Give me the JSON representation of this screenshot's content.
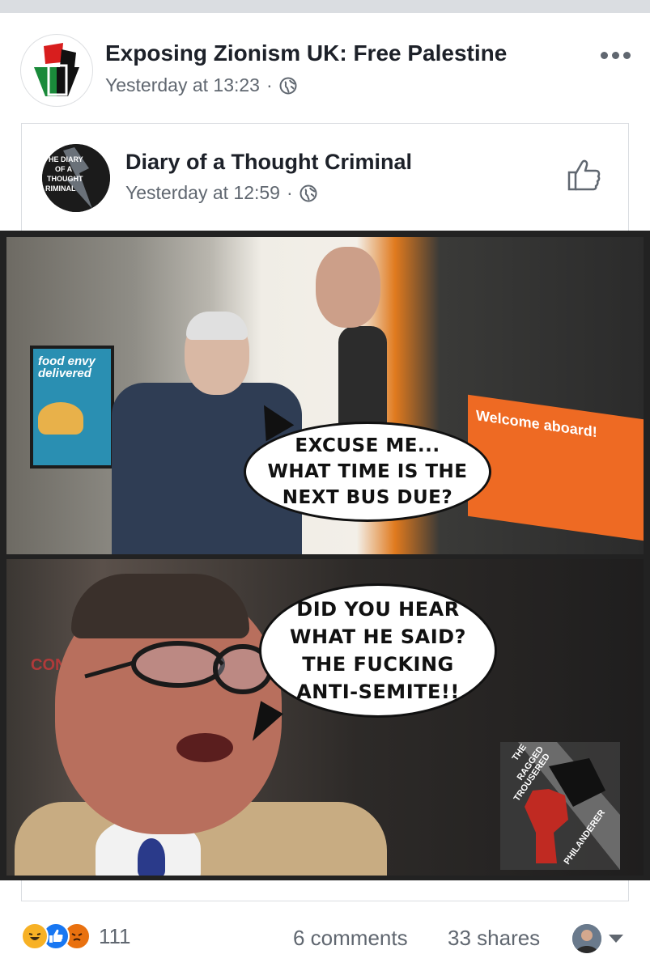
{
  "post": {
    "page_name": "Exposing Zionism UK: Free Palestine",
    "timestamp": "Yesterday at 13:23",
    "separator": "·",
    "privacy_icon": "globe-icon",
    "menu_icon": "more-options-icon"
  },
  "shared_post": {
    "page_name": "Diary of a Thought Criminal",
    "timestamp": "Yesterday at 12:59",
    "separator": "·",
    "privacy_icon": "globe-icon",
    "avatar_text": [
      "HE DIARY",
      "OF A",
      "THOUGHT",
      "RIMINAL"
    ],
    "like_icon": "thumbs-up-icon"
  },
  "meme": {
    "panel_top": {
      "bubble_lines": [
        "EXCUSE ME...",
        "WHAT TIME IS THE",
        "NEXT BUS DUE?"
      ],
      "poster_lines": [
        "food",
        "envy",
        "delivered"
      ],
      "bus_sign": "Welcome aboard!"
    },
    "panel_bottom": {
      "bubble_lines": [
        "DID YOU HEAR",
        "WHAT HE SAID?",
        "THE FUCKING",
        "ANTI-SEMITE!!"
      ],
      "background_text": "CONTRO",
      "watermark_lines": [
        "THE",
        "RAGGED",
        "TROUSERED",
        "PHILANDERER"
      ]
    }
  },
  "footer": {
    "reaction_icons": [
      "haha-icon",
      "like-icon",
      "angry-icon"
    ],
    "reaction_count": "111",
    "comments": "6 comments",
    "shares": "33 shares"
  },
  "colors": {
    "text_primary": "#1d2129",
    "text_secondary": "#606770",
    "like_blue": "#1877f2",
    "haha_yellow": "#f7b125",
    "angry_orange": "#e9710f",
    "bus_orange": "#ee6a23"
  }
}
